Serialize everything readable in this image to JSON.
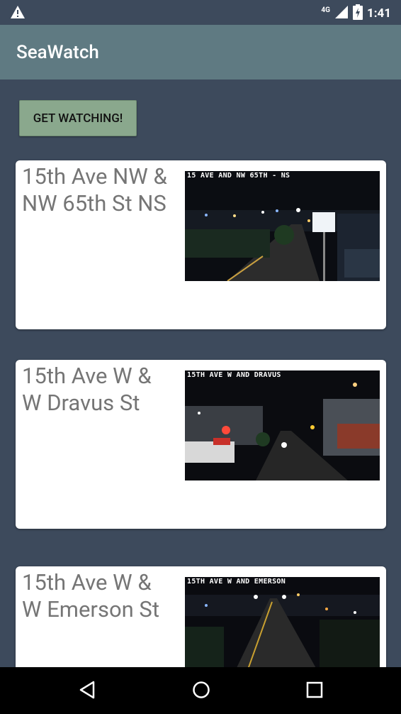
{
  "status_bar": {
    "network": "4G",
    "time": "1:41"
  },
  "app": {
    "title": "SeaWatch"
  },
  "main": {
    "cta_label": "GET WATCHING!",
    "cameras": [
      {
        "title": "15th Ave NW & NW 65th St NS",
        "overlay": "15 AVE AND NW 65TH - NS"
      },
      {
        "title": "15th Ave W & W Dravus St",
        "overlay": "15TH AVE W AND DRAVUS"
      },
      {
        "title": "15th Ave W & W Emerson St",
        "overlay": "15TH AVE W AND EMERSON"
      }
    ]
  },
  "icons": {
    "status": [
      "warning-icon",
      "signal-icon",
      "battery-icon"
    ],
    "nav": [
      "back-icon",
      "home-icon",
      "recents-icon"
    ]
  }
}
